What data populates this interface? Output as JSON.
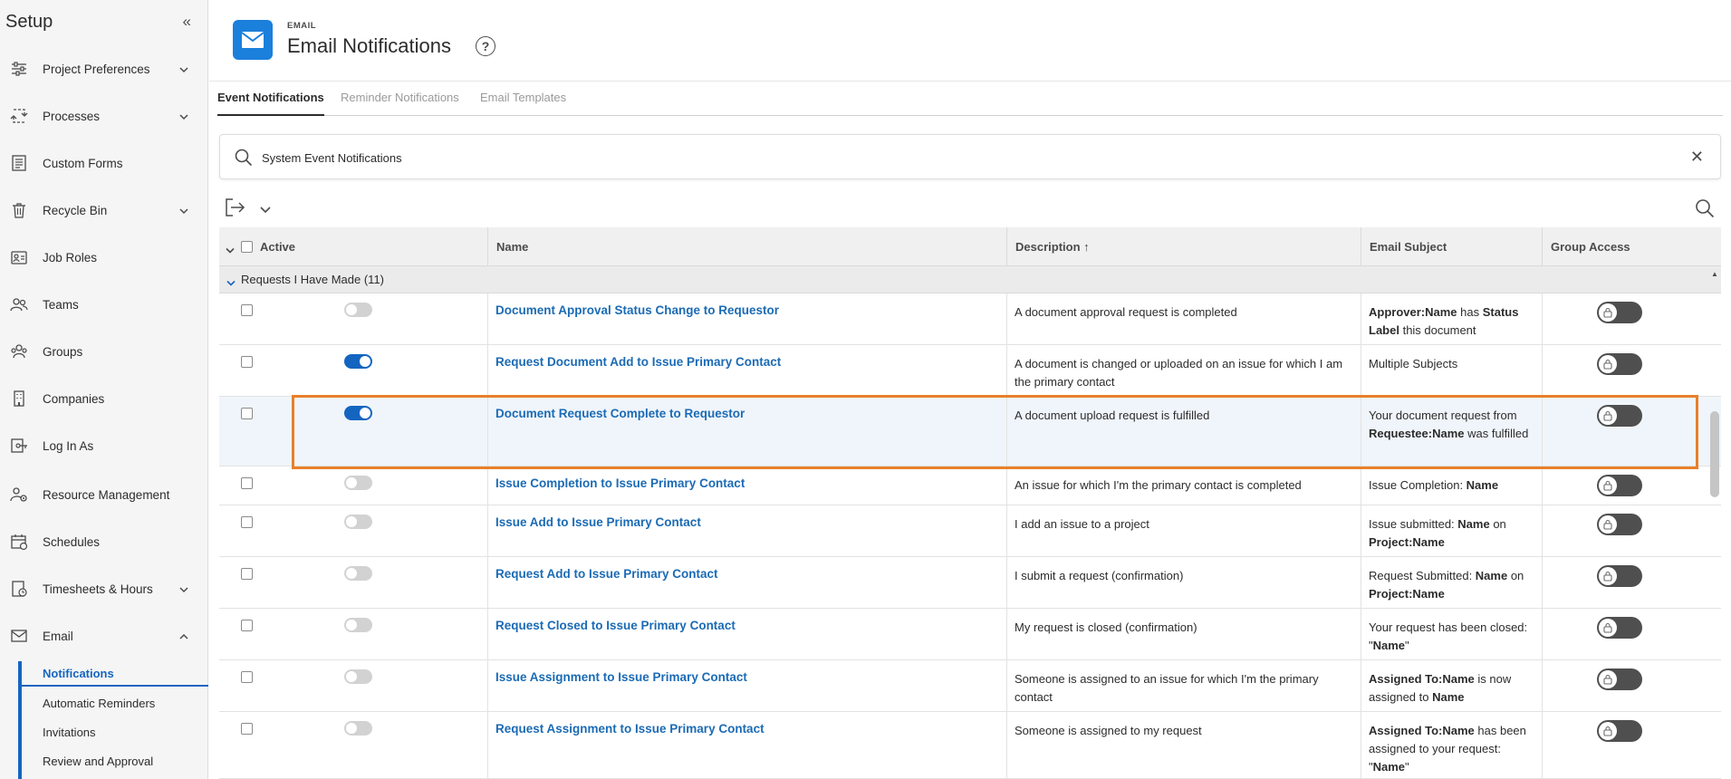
{
  "sidebar": {
    "title": "Setup",
    "collapse_icon": "double-chevron-left-icon",
    "items": [
      {
        "label": "Project Preferences",
        "icon": "sliders-icon",
        "chevron": "down"
      },
      {
        "label": "Processes",
        "icon": "process-icon",
        "chevron": "down"
      },
      {
        "label": "Custom Forms",
        "icon": "form-icon",
        "chevron": ""
      },
      {
        "label": "Recycle Bin",
        "icon": "trash-icon",
        "chevron": "down"
      },
      {
        "label": "Job Roles",
        "icon": "job-role-icon",
        "chevron": ""
      },
      {
        "label": "Teams",
        "icon": "teams-icon",
        "chevron": ""
      },
      {
        "label": "Groups",
        "icon": "groups-icon",
        "chevron": ""
      },
      {
        "label": "Companies",
        "icon": "building-icon",
        "chevron": ""
      },
      {
        "label": "Log In As",
        "icon": "key-icon",
        "chevron": ""
      },
      {
        "label": "Resource Management",
        "icon": "resource-icon",
        "chevron": ""
      },
      {
        "label": "Schedules",
        "icon": "calendar-icon",
        "chevron": ""
      },
      {
        "label": "Timesheets & Hours",
        "icon": "timesheet-icon",
        "chevron": "down"
      },
      {
        "label": "Email",
        "icon": "mail-icon",
        "chevron": "up"
      }
    ],
    "subitems": [
      {
        "label": "Notifications",
        "active": true
      },
      {
        "label": "Automatic Reminders",
        "active": false
      },
      {
        "label": "Invitations",
        "active": false
      },
      {
        "label": "Review and Approval",
        "active": false
      }
    ]
  },
  "header": {
    "eyebrow": "EMAIL",
    "title": "Email Notifications",
    "help": "?"
  },
  "tabs": [
    {
      "label": "Event Notifications",
      "active": true
    },
    {
      "label": "Reminder Notifications",
      "active": false
    },
    {
      "label": "Email Templates",
      "active": false
    }
  ],
  "search": {
    "value": "System Event Notifications",
    "clear": "✕"
  },
  "table": {
    "columns": {
      "active": "Active",
      "name": "Name",
      "description": "Description ↑",
      "subject": "Email Subject",
      "group_access": "Group Access"
    },
    "group": "Requests I Have Made (11)",
    "rows": [
      {
        "active": false,
        "name": "Document Approval Status Change to Requestor",
        "description": "A document approval request is completed",
        "subject": [
          {
            "t": "Approver:Name",
            "b": true
          },
          {
            "t": " has ",
            "b": false
          },
          {
            "t": "Status Label",
            "b": true
          },
          {
            "t": " this document",
            "b": false
          }
        ]
      },
      {
        "active": true,
        "name": "Request Document Add to Issue Primary Contact",
        "description": "A document is changed or uploaded on an issue for which I am the primary contact",
        "subject": [
          {
            "t": "Multiple Subjects",
            "b": false
          }
        ]
      },
      {
        "active": true,
        "name": "Document Request Complete to Requestor",
        "description": "A document upload request is fulfilled",
        "subject": [
          {
            "t": "Your document request from ",
            "b": false
          },
          {
            "t": "Requestee:Name",
            "b": true
          },
          {
            "t": " was fulfilled",
            "b": false
          }
        ]
      },
      {
        "active": false,
        "name": "Issue Completion to Issue Primary Contact",
        "description": "An issue for which I'm the primary contact is completed",
        "subject": [
          {
            "t": "Issue Completion: ",
            "b": false
          },
          {
            "t": "Name",
            "b": true
          }
        ]
      },
      {
        "active": false,
        "name": "Issue Add to Issue Primary Contact",
        "description": "I add an issue to a project",
        "subject": [
          {
            "t": "Issue submitted: ",
            "b": false
          },
          {
            "t": "Name",
            "b": true
          },
          {
            "t": " on ",
            "b": false
          },
          {
            "t": "Project:Name",
            "b": true
          }
        ]
      },
      {
        "active": false,
        "name": "Request Add to Issue Primary Contact",
        "description": "I submit a request (confirmation)",
        "subject": [
          {
            "t": "Request Submitted: ",
            "b": false
          },
          {
            "t": "Name",
            "b": true
          },
          {
            "t": " on ",
            "b": false
          },
          {
            "t": "Project:Name",
            "b": true
          }
        ]
      },
      {
        "active": false,
        "name": "Request Closed to Issue Primary Contact",
        "description": "My request is closed (confirmation)",
        "subject": [
          {
            "t": "Your request has been closed: \"",
            "b": false
          },
          {
            "t": "Name",
            "b": true
          },
          {
            "t": "\"",
            "b": false
          }
        ]
      },
      {
        "active": false,
        "name": "Issue Assignment to Issue Primary Contact",
        "description": "Someone is assigned to an issue for which I'm the primary contact",
        "subject": [
          {
            "t": "Assigned To:Name",
            "b": true
          },
          {
            "t": " is now assigned to ",
            "b": false
          },
          {
            "t": "Name",
            "b": true
          }
        ]
      },
      {
        "active": false,
        "name": "Request Assignment to Issue Primary Contact",
        "description": "Someone is assigned to my request",
        "subject": [
          {
            "t": "Assigned To:Name",
            "b": true
          },
          {
            "t": " has been assigned to your request: \"",
            "b": false
          },
          {
            "t": "Name",
            "b": true
          },
          {
            "t": "\"",
            "b": false
          }
        ]
      }
    ]
  },
  "colors": {
    "accent": "#1465c0",
    "highlight": "#e8802b",
    "link": "#1b6bb5",
    "header_icon": "#1b7fdc"
  }
}
